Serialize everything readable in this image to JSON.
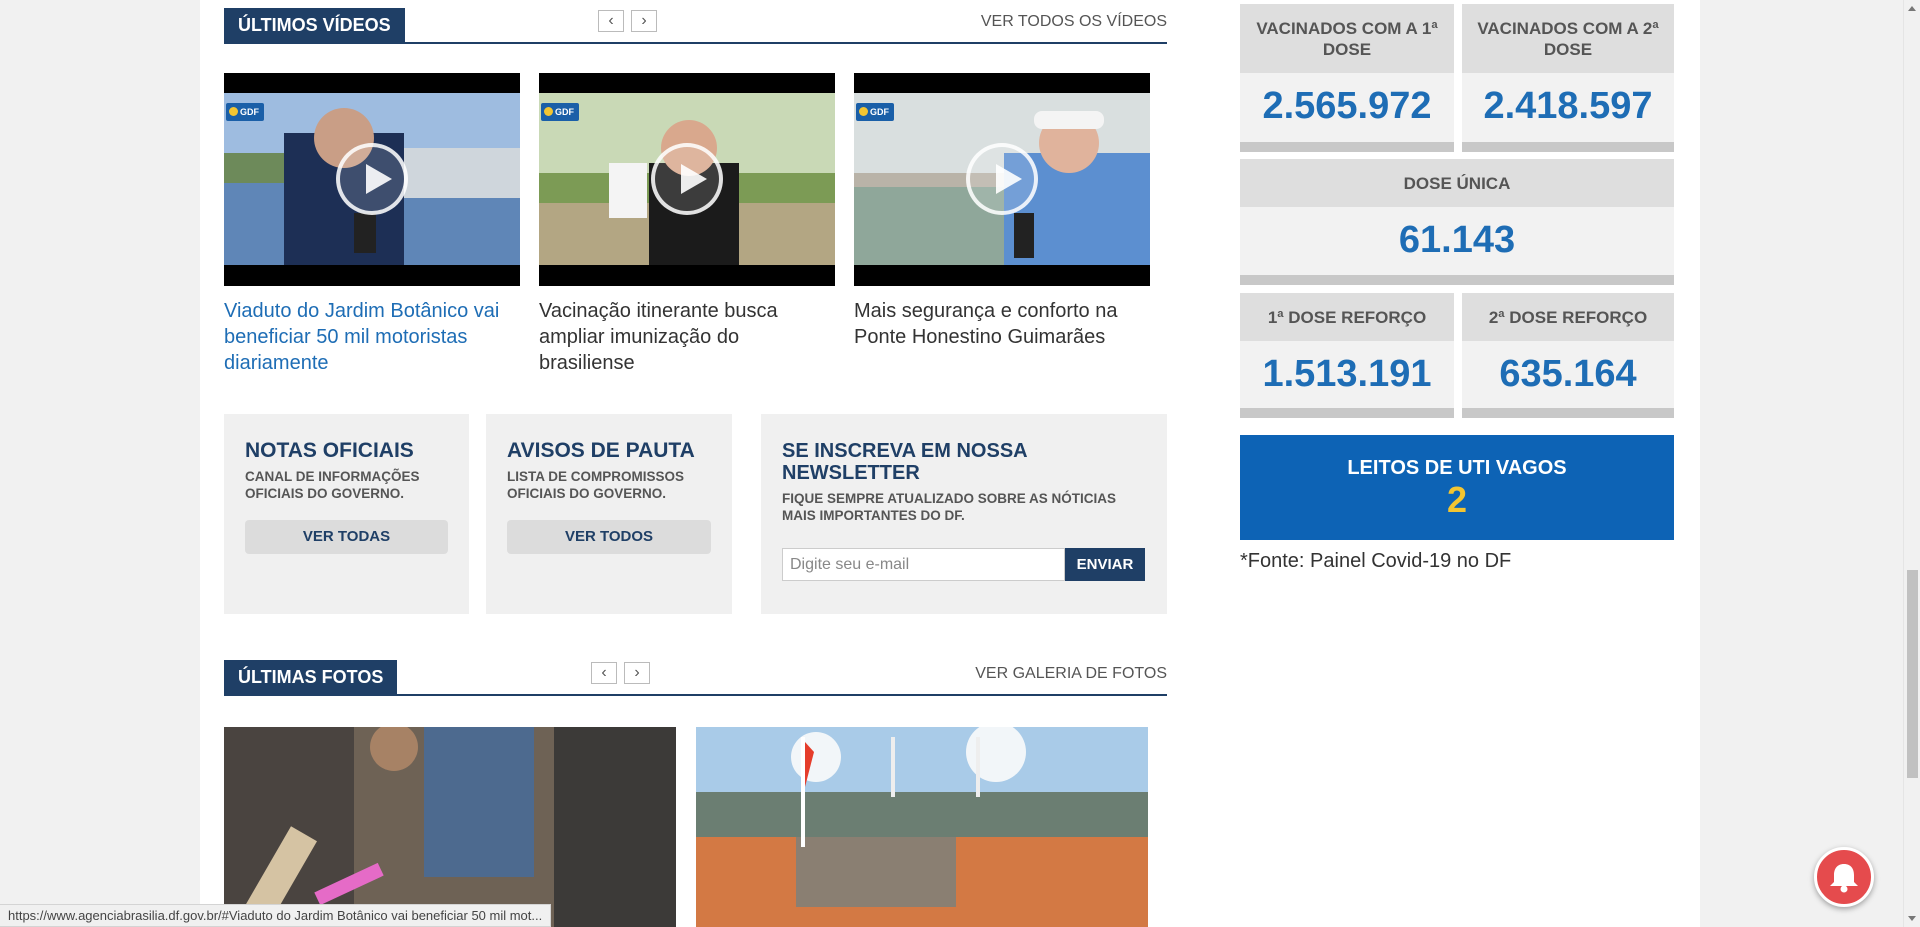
{
  "videos_section": {
    "title": "ÚLTIMOS VÍDEOS",
    "prev_arrow": "‹",
    "next_arrow": "›",
    "see_all": "VER TODOS OS VÍDEOS",
    "items": [
      {
        "title": "Viaduto do Jardim Botânico vai beneficiar 50 mil motoristas diariamente",
        "badge": "GDF"
      },
      {
        "title": "Vacinação itinerante busca ampliar imunização do brasiliense",
        "badge": "GDF"
      },
      {
        "title": "Mais segurança e conforto na Ponte Honestino Guimarães",
        "badge": "GDF"
      }
    ]
  },
  "notas": {
    "title": "NOTAS OFICIAIS",
    "subtitle": "CANAL DE INFORMAÇÕES OFICIAIS DO GOVERNO.",
    "button": "VER TODAS"
  },
  "avisos": {
    "title": "AVISOS DE PAUTA",
    "subtitle": "LISTA DE COMPROMISSOS OFICIAIS DO GOVERNO.",
    "button": "VER TODOS"
  },
  "newsletter": {
    "title": "SE INSCREVA EM NOSSA NEWSLETTER",
    "subtitle": "FIQUE SEMPRE ATUALIZADO SOBRE AS NÓTICIAS MAIS IMPORTANTES DO DF.",
    "placeholder": "Digite seu e-mail",
    "button": "ENVIAR"
  },
  "photos_section": {
    "title": "ÚLTIMAS FOTOS",
    "prev_arrow": "‹",
    "next_arrow": "›",
    "see_all": "VER GALERIA DE FOTOS"
  },
  "covid": {
    "dose1": {
      "label": "VACINADOS COM A 1ª DOSE",
      "value": "2.565.972"
    },
    "dose2": {
      "label": "VACINADOS COM A 2ª DOSE",
      "value": "2.418.597"
    },
    "unica": {
      "label": "DOSE ÚNICA",
      "value": "61.143"
    },
    "reforco1": {
      "label": "1ª DOSE REFORÇO",
      "value": "1.513.191"
    },
    "reforco2": {
      "label": "2ª DOSE REFORÇO",
      "value": "635.164"
    },
    "uti": {
      "label": "LEITOS DE UTI VAGOS",
      "value": "2"
    },
    "fonte": "*Fonte: Painel Covid-19 no DF"
  },
  "status_bar": "https://www.agenciabrasilia.df.gov.br/#Viaduto do Jardim Botânico vai beneficiar 50 mil mot...",
  "colors": {
    "navy": "#1f3f66",
    "blue": "#1e6db5",
    "uti_bg": "#0d63b5",
    "yellow": "#f3c531",
    "bell": "#e54b4d"
  },
  "icons": {
    "play": "play-icon",
    "bell": "bell-icon",
    "arrows": "chevron-icon"
  }
}
